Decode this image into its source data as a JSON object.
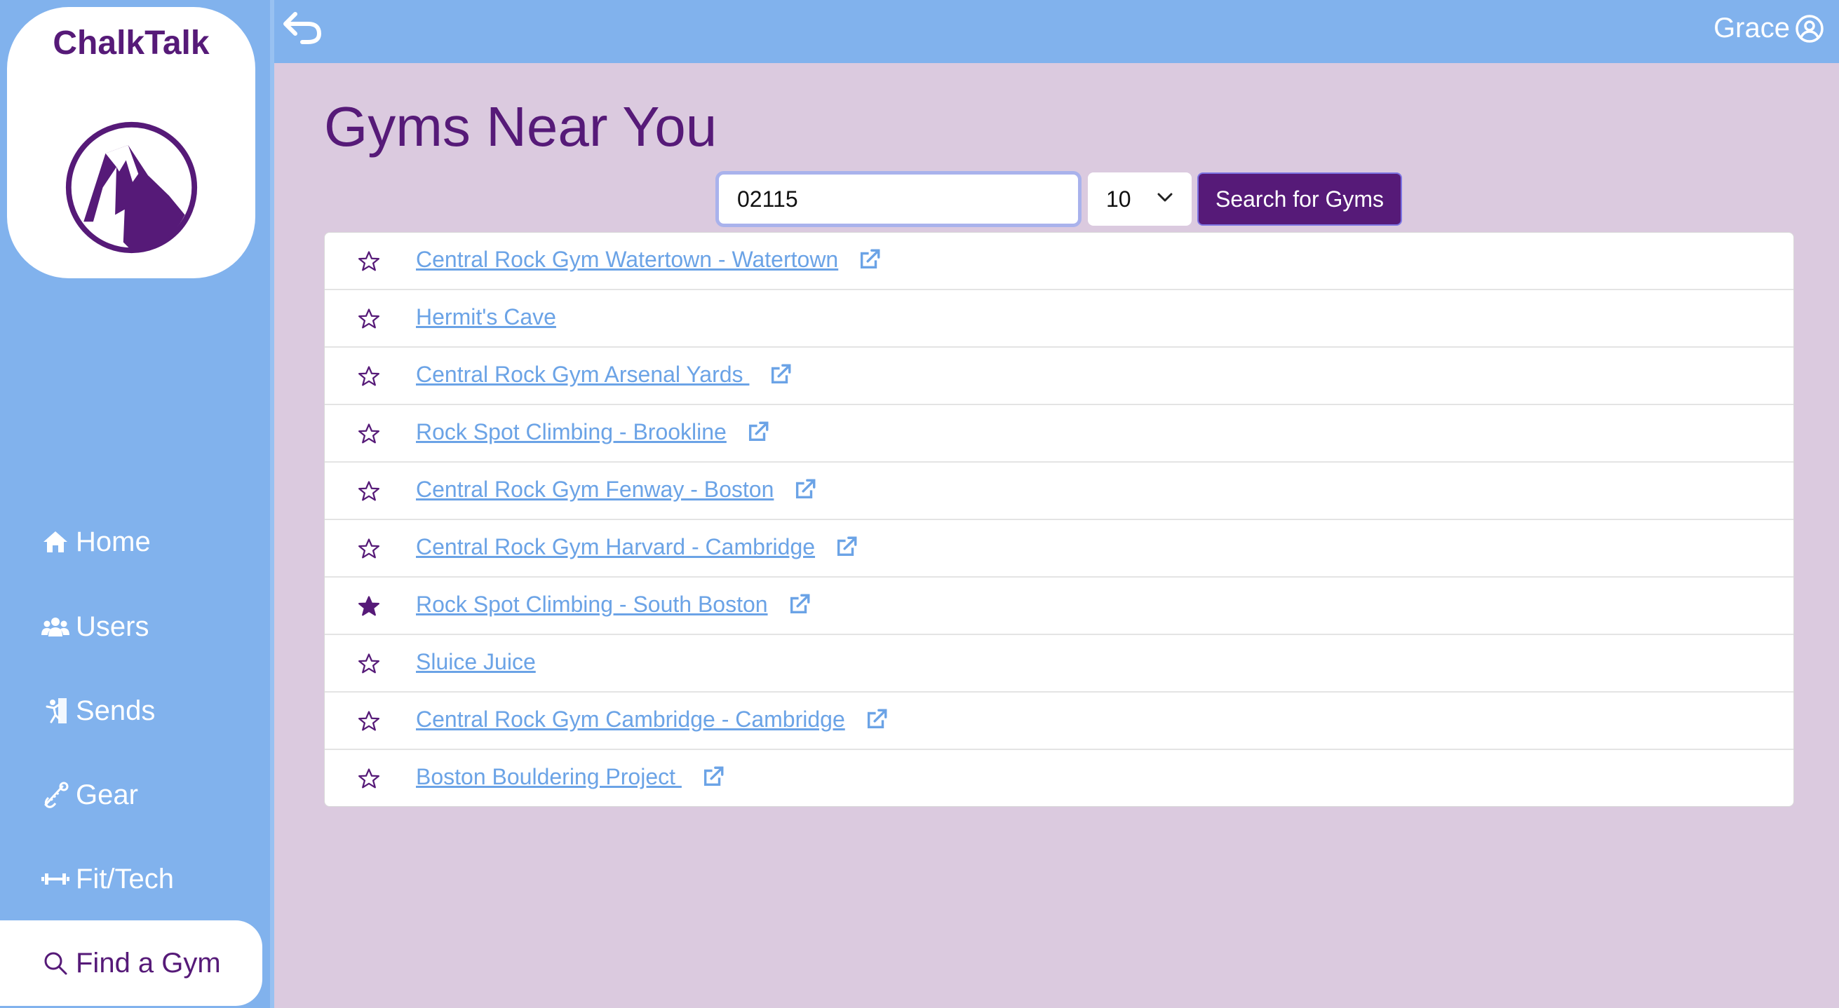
{
  "app": {
    "name": "ChalkTalk",
    "brand_color": "#561a78",
    "sidebar_color": "#81b2ed",
    "link_color": "#6ba3e6"
  },
  "nav": {
    "items": [
      {
        "label": "Home",
        "icon": "home-icon"
      },
      {
        "label": "Users",
        "icon": "users-icon"
      },
      {
        "label": "Sends",
        "icon": "climber-icon"
      },
      {
        "label": "Gear",
        "icon": "carabiner-icon"
      },
      {
        "label": "Fit/Tech",
        "icon": "dumbbell-icon"
      }
    ],
    "active": {
      "label": "Find a Gym",
      "icon": "search-icon"
    }
  },
  "header": {
    "user_name": "Grace"
  },
  "main": {
    "title": "Gyms Near You",
    "search": {
      "value": "02115",
      "radius": "10",
      "button_label": "Search for Gyms"
    },
    "gyms": [
      {
        "name": "Central Rock Gym Watertown - Watertown",
        "favorite": false,
        "external": true
      },
      {
        "name": "Hermit's Cave",
        "favorite": false,
        "external": false
      },
      {
        "name": "Central Rock Gym Arsenal Yards ",
        "favorite": false,
        "external": true
      },
      {
        "name": "Rock Spot Climbing - Brookline",
        "favorite": false,
        "external": true
      },
      {
        "name": "Central Rock Gym Fenway - Boston",
        "favorite": false,
        "external": true
      },
      {
        "name": "Central Rock Gym Harvard - Cambridge",
        "favorite": false,
        "external": true
      },
      {
        "name": "Rock Spot Climbing - South Boston",
        "favorite": true,
        "external": true
      },
      {
        "name": "Sluice Juice",
        "favorite": false,
        "external": false
      },
      {
        "name": "Central Rock Gym Cambridge - Cambridge",
        "favorite": false,
        "external": true
      },
      {
        "name": "Boston Bouldering Project ",
        "favorite": false,
        "external": true
      }
    ]
  }
}
